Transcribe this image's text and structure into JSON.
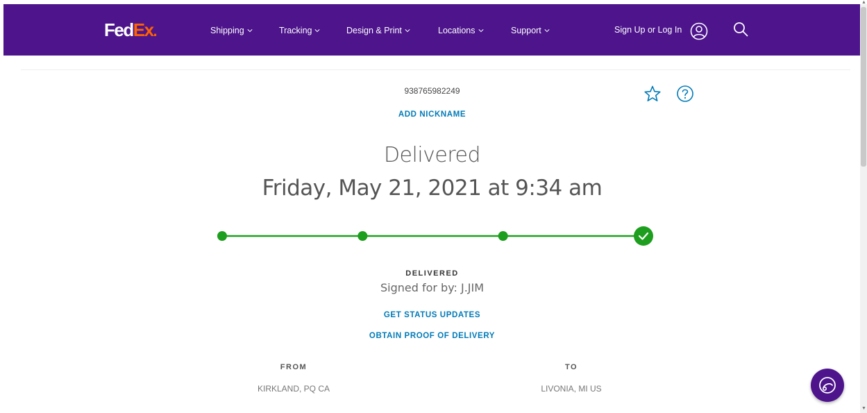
{
  "brand": {
    "logo_fed": "Fed",
    "logo_ex": "Ex",
    "logo_dot": ".",
    "purple": "#4d148c",
    "orange": "#ff6200",
    "link_blue": "#007ab7",
    "progress_green": "#1e9e1e"
  },
  "nav": {
    "items": [
      {
        "label": "Shipping"
      },
      {
        "label": "Tracking"
      },
      {
        "label": "Design & Print"
      },
      {
        "label": "Locations"
      },
      {
        "label": "Support"
      }
    ],
    "signin_label": "Sign Up or Log In",
    "icons": [
      "user-icon",
      "search-icon",
      "chevron-down-icon"
    ]
  },
  "tracking": {
    "number": "938765982249",
    "add_nickname": "ADD NICKNAME",
    "status_heading": "Delivered",
    "delivered_date": "Friday, May 21, 2021 at 9:34 am",
    "progress": {
      "steps_total": 4,
      "steps_completed": 4
    },
    "status_label": "DELIVERED",
    "signed_for": "Signed for by: J.JIM",
    "get_status_updates": "GET STATUS UPDATES",
    "obtain_proof": "OBTAIN PROOF OF DELIVERY",
    "from_label": "FROM",
    "from_value": "KIRKLAND, PQ CA",
    "to_label": "TO",
    "to_value": "LIVONIA, MI US",
    "icons": [
      "star-icon",
      "help-icon",
      "checkmark-icon",
      "chat-icon"
    ]
  }
}
